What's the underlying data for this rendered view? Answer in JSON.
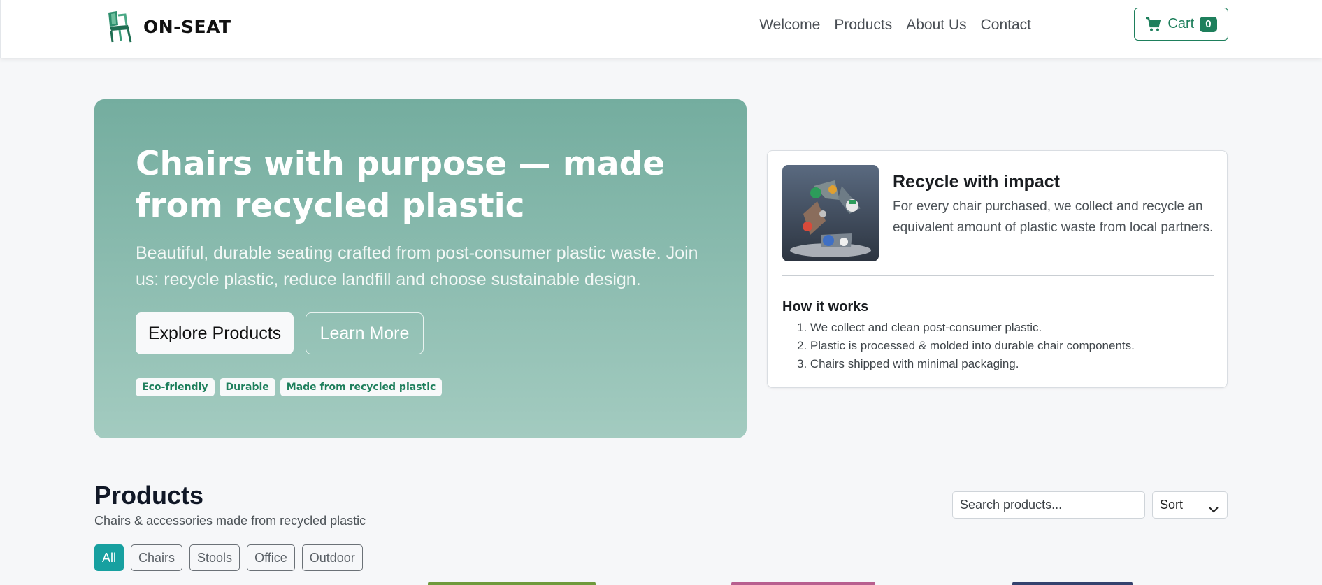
{
  "navbar": {
    "brand": "ON-SEAT",
    "links": [
      "Welcome",
      "Products",
      "About Us",
      "Contact"
    ],
    "cart_label": "Cart",
    "cart_count": "0"
  },
  "hero": {
    "title": "Chairs with purpose — made from recycled plastic",
    "subtitle": "Beautiful, durable seating crafted from post-consumer plastic waste. Join us: recycle plastic, reduce landfill and choose sustainable design.",
    "primary_button": "Explore Products",
    "secondary_button": "Learn More",
    "tags": [
      "Eco-friendly",
      "Durable",
      "Made from recycled plastic"
    ]
  },
  "impact": {
    "title": "Recycle with impact",
    "text": "For every chair purchased, we collect and recycle an equivalent amount of plastic waste from local partners.",
    "how_title": "How it works",
    "steps": [
      "1. We collect and clean post-consumer plastic.",
      "2. Plastic is processed & molded into durable chair components.",
      "3. Chairs shipped with minimal packaging."
    ]
  },
  "products": {
    "title": "Products",
    "subtitle": "Chairs & accessories made from recycled plastic",
    "search_placeholder": "Search products...",
    "sort_label": "Sort",
    "filters": [
      "All",
      "Chairs",
      "Stools",
      "Office",
      "Outdoor"
    ],
    "active_filter": "All"
  },
  "colors": {
    "accent": "#1e7f5c",
    "filter_active": "#17a0a0",
    "hero_top": "#74ad9f",
    "hero_bottom": "#a3cbc0"
  },
  "icons": {
    "brand": "chair-logo-icon",
    "cart": "shopping-cart-icon",
    "sort": "chevron-down-icon"
  }
}
